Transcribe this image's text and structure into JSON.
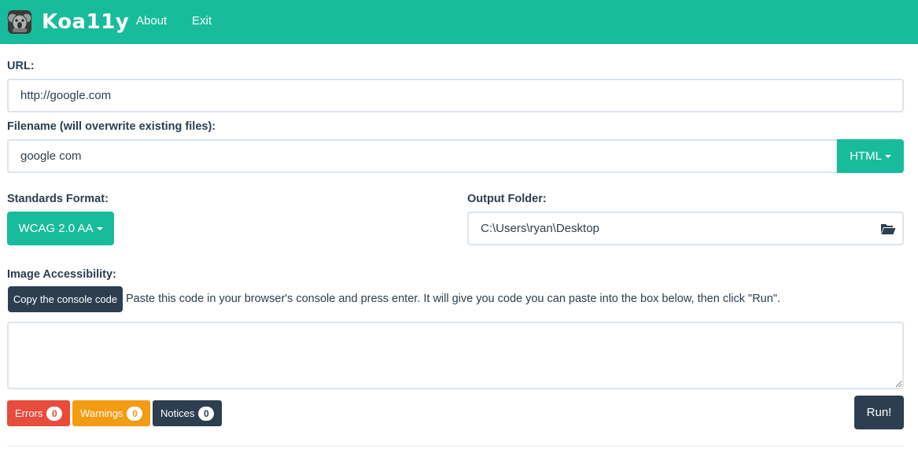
{
  "navbar": {
    "brand": "Koa11y",
    "links": [
      "About",
      "Exit"
    ],
    "color": "#18bc9c"
  },
  "url": {
    "label": "URL:",
    "value": "http://google.com"
  },
  "filename": {
    "label": "Filename (will overwrite existing files):",
    "value": "google com",
    "format_button": "HTML"
  },
  "standards": {
    "label": "Standards Format:",
    "selected": "WCAG 2.0 AA"
  },
  "output": {
    "label": "Output Folder:",
    "value": "C:\\Users\\ryan\\Desktop",
    "icon": "folder-open-icon"
  },
  "image_accessibility": {
    "label": "Image Accessibility:",
    "copy_button": "Copy the console code",
    "hint": "Paste this code in your browser's console and press enter. It will give you code you can paste into the box below, then click \"Run\".",
    "textarea_value": ""
  },
  "results": {
    "errors_label": "Errors",
    "errors_count": "0",
    "errors_color": "#e74c3c",
    "warnings_label": "Warnings",
    "warnings_count": "0",
    "warnings_color": "#f39c12",
    "notices_label": "Notices",
    "notices_count": "0",
    "notices_color": "#2c3e50"
  },
  "run_button": "Run!"
}
